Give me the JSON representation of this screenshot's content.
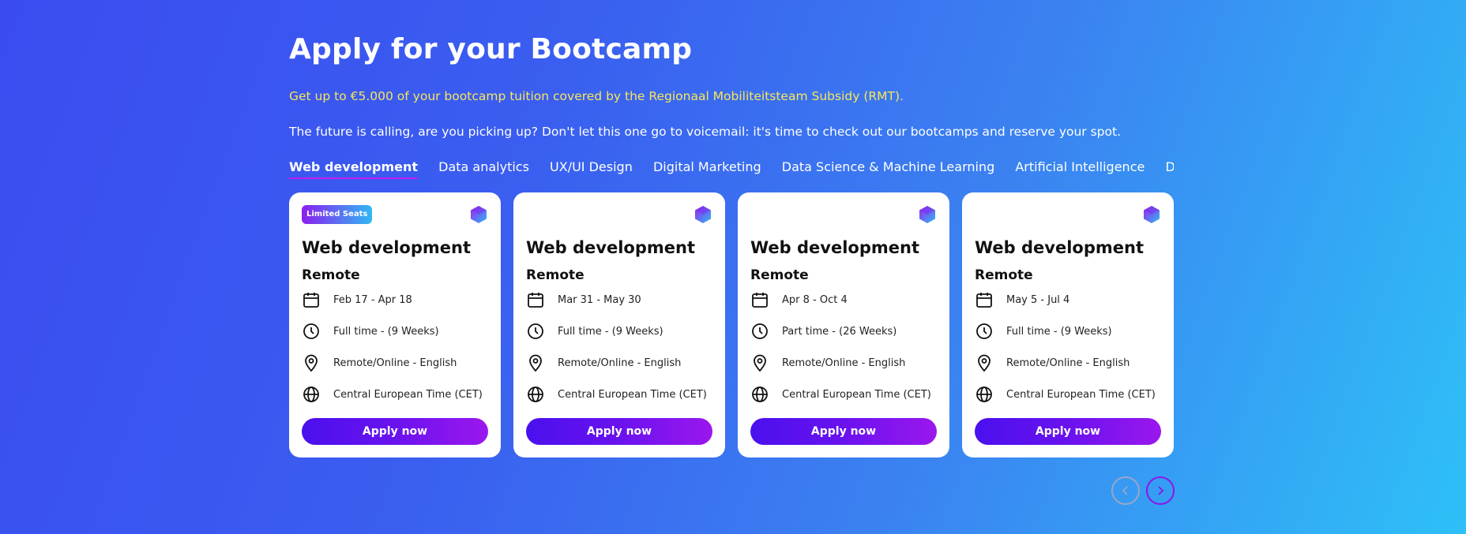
{
  "header": {
    "title": "Apply for your Bootcamp",
    "subsidy": "Get up to €5.000 of your bootcamp tuition covered by the Regionaal Mobiliteitsteam Subsidy (RMT).",
    "intro": "The future is calling, are you picking up? Don't let this one go to voicemail: it's time to check out our bootcamps and reserve your spot."
  },
  "tabs": [
    {
      "label": "Web development",
      "active": true
    },
    {
      "label": "Data analytics",
      "active": false
    },
    {
      "label": "UX/UI Design",
      "active": false
    },
    {
      "label": "Digital Marketing",
      "active": false
    },
    {
      "label": "Data Science & Machine Learning",
      "active": false
    },
    {
      "label": "Artificial Intelligence",
      "active": false
    },
    {
      "label": "DevOps & Cloud Computing",
      "active": false
    }
  ],
  "cards": [
    {
      "badge": "Limited Seats",
      "title": "Web development",
      "mode": "Remote",
      "dates": "Feb 17 - Apr 18",
      "schedule": "Full time - (9 Weeks)",
      "location": "Remote/Online - English",
      "timezone": "Central European Time (CET)",
      "cta": "Apply now"
    },
    {
      "badge": "",
      "title": "Web development",
      "mode": "Remote",
      "dates": "Mar 31 - May 30",
      "schedule": "Full time - (9 Weeks)",
      "location": "Remote/Online - English",
      "timezone": "Central European Time (CET)",
      "cta": "Apply now"
    },
    {
      "badge": "",
      "title": "Web development",
      "mode": "Remote",
      "dates": "Apr 8 - Oct 4",
      "schedule": "Part time - (26 Weeks)",
      "location": "Remote/Online - English",
      "timezone": "Central European Time (CET)",
      "cta": "Apply now"
    },
    {
      "badge": "",
      "title": "Web development",
      "mode": "Remote",
      "dates": "May 5 - Jul 4",
      "schedule": "Full time - (9 Weeks)",
      "location": "Remote/Online - English",
      "timezone": "Central European Time (CET)",
      "cta": "Apply now"
    }
  ],
  "icons": {
    "dates": "calendar-icon",
    "schedule": "clock-icon",
    "location": "map-pin-icon",
    "timezone": "globe-icon",
    "logo": "hexagon-logo-icon",
    "prev": "chevron-left-icon",
    "next": "chevron-right-icon"
  },
  "colors": {
    "subsidy_text": "#f6e75a",
    "active_tab_underline": "#c21ef0",
    "button_start": "#4a10ee",
    "button_end": "#9b17ee"
  }
}
